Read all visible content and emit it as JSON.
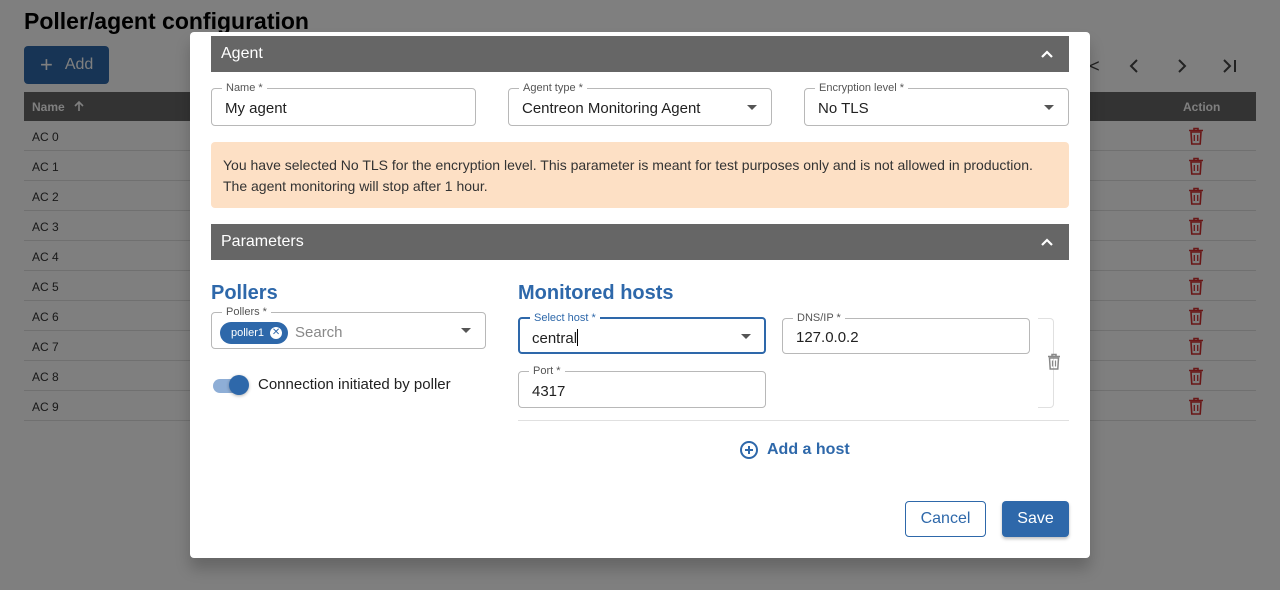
{
  "page": {
    "title": "Poller/agent configuration",
    "add_label": "Add",
    "table": {
      "col_name": "Name",
      "col_action": "Action",
      "rows": [
        "AC 0",
        "AC 1",
        "AC 2",
        "AC 3",
        "AC 4",
        "AC 5",
        "AC 6",
        "AC 7",
        "AC 8",
        "AC 9"
      ]
    }
  },
  "modal": {
    "agent_section": "Agent",
    "name": {
      "label": "Name *",
      "value": "My agent"
    },
    "agent_type": {
      "label": "Agent type *",
      "value": "Centreon Monitoring Agent"
    },
    "encryption": {
      "label": "Encryption level *",
      "value": "No TLS"
    },
    "warning": {
      "line1": "You have selected No TLS for the encryption level. This parameter is meant for test purposes only and is not allowed in production.",
      "line2": "The agent monitoring will stop after 1 hour."
    },
    "parameters_section": "Parameters",
    "pollers_heading": "Pollers",
    "pollers": {
      "label": "Pollers *",
      "chip": "poller1",
      "placeholder": "Search"
    },
    "connection_toggle": {
      "label": "Connection initiated by poller",
      "on": true
    },
    "hosts_heading": "Monitored hosts",
    "select_host": {
      "label": "Select host *",
      "value": "central"
    },
    "dns_ip": {
      "label": "DNS/IP *",
      "value": "127.0.0.2"
    },
    "port": {
      "label": "Port *",
      "value": "4317"
    },
    "add_host_label": "Add a host",
    "cancel_label": "Cancel",
    "save_label": "Save"
  },
  "colors": {
    "primary": "#2e68aa",
    "section_bar": "#666666",
    "warning_bg": "#fde0c5",
    "delete_icon": "#d32f2f"
  },
  "icons": [
    "plus-icon",
    "sort-arrow-up-icon",
    "pagination-first-icon",
    "pagination-prev-icon",
    "pagination-next-icon",
    "pagination-last-icon",
    "trash-icon",
    "chevron-up-icon",
    "dropdown-caret-icon",
    "chip-remove-icon",
    "add-circle-icon"
  ]
}
